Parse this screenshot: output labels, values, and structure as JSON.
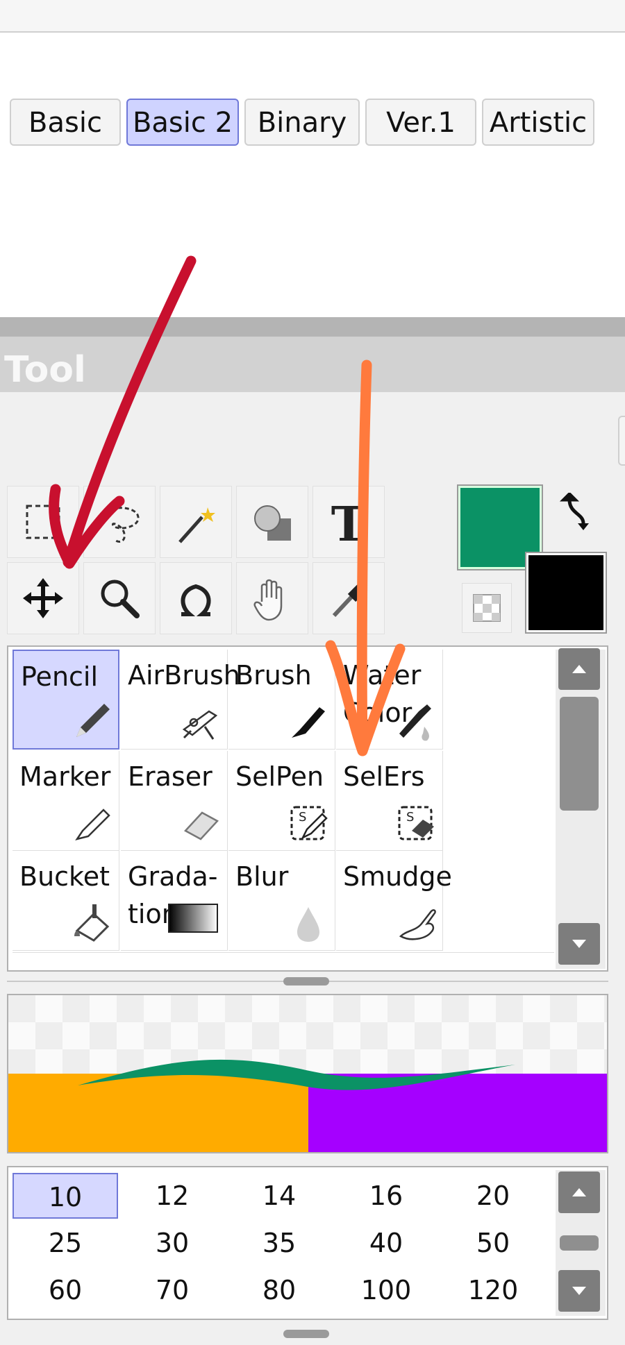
{
  "panel": {
    "title": "Tool"
  },
  "tabs": [
    {
      "label": "Basic",
      "active": false
    },
    {
      "label": "Basic 2",
      "active": true
    },
    {
      "label": "Binary",
      "active": false
    },
    {
      "label": "Ver.1",
      "active": false
    },
    {
      "label": "Artistic",
      "active": false
    }
  ],
  "tool_buttons": [
    "rect-select-icon",
    "lasso-icon",
    "magic-wand-icon",
    "shapes-icon",
    "text-icon",
    "move-icon",
    "zoom-icon",
    "rotate-icon",
    "hand-icon",
    "eyedropper-icon"
  ],
  "text_tool_glyph": "T",
  "colors": {
    "primary": "#0b9265",
    "secondary": "#000000",
    "accent": "#6f78d8",
    "annotation_red": "#c8102e",
    "annotation_orange": "#ff7a3d"
  },
  "brushes": [
    {
      "label": "Pencil",
      "icon": "pencil-icon",
      "active": true
    },
    {
      "label": "AirBrush",
      "icon": "airbrush-icon",
      "active": false
    },
    {
      "label": "Brush",
      "icon": "brush-icon",
      "active": false
    },
    {
      "label": "Water\nColor",
      "icon": "watercolor-icon",
      "active": false
    },
    {
      "label": "Marker",
      "icon": "marker-icon",
      "active": false
    },
    {
      "label": "Eraser",
      "icon": "eraser-icon",
      "active": false
    },
    {
      "label": "SelPen",
      "icon": "selpen-icon",
      "active": false
    },
    {
      "label": "SelErs",
      "icon": "selers-icon",
      "active": false
    },
    {
      "label": "Bucket",
      "icon": "bucket-icon",
      "active": false
    },
    {
      "label": "Grada-\ntion",
      "icon": "gradation-icon",
      "active": false
    },
    {
      "label": "Blur",
      "icon": "blur-icon",
      "active": false
    },
    {
      "label": "Smudge",
      "icon": "smudge-icon",
      "active": false
    }
  ],
  "sizes": [
    "10",
    "12",
    "14",
    "16",
    "20",
    "25",
    "30",
    "35",
    "40",
    "50",
    "60",
    "70",
    "80",
    "100",
    "120"
  ],
  "selected_size": "10",
  "preview": {
    "left_color": "#ffab00",
    "right_color": "#a500ff",
    "stroke_color": "#0b9265"
  }
}
